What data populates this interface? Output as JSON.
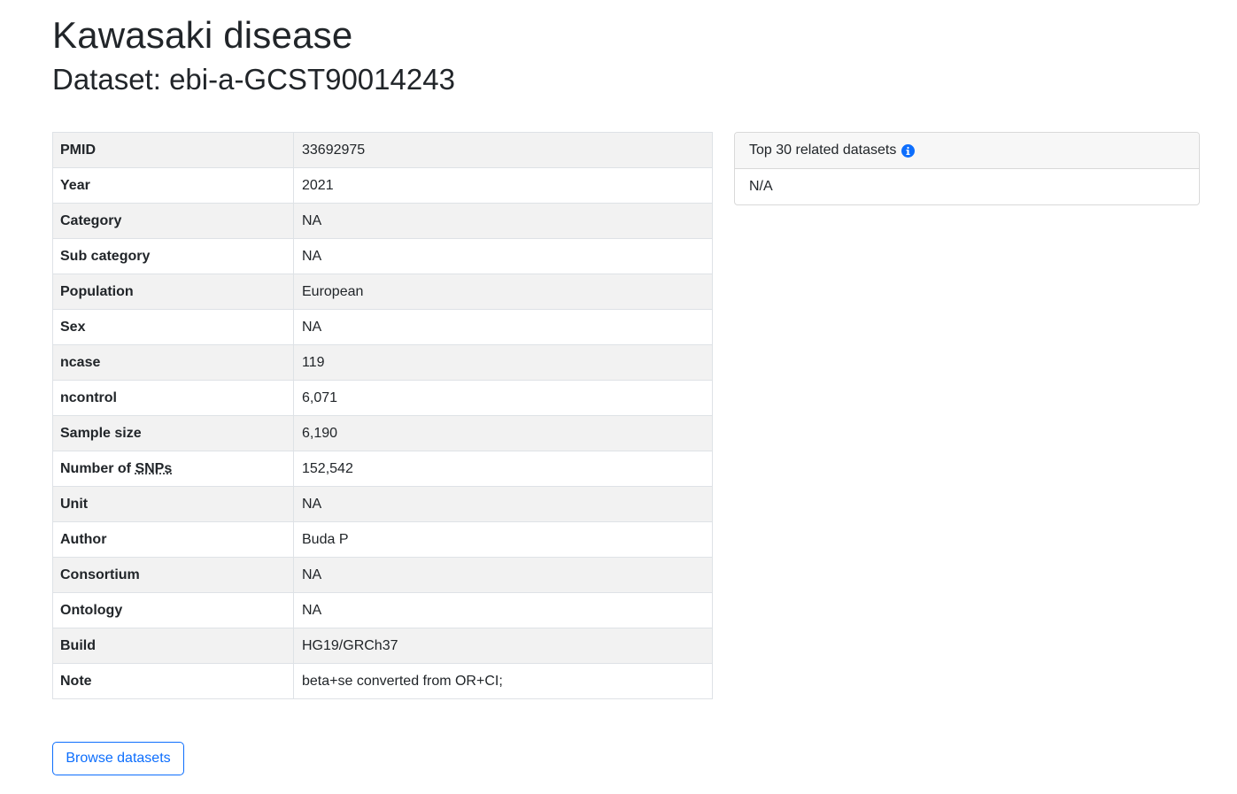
{
  "header": {
    "title": "Kawasaki disease",
    "subtitle": "Dataset: ebi-a-GCST90014243"
  },
  "details": {
    "rows": [
      {
        "key": "PMID",
        "value": "33692975"
      },
      {
        "key": "Year",
        "value": "2021"
      },
      {
        "key": "Category",
        "value": "NA"
      },
      {
        "key": "Sub category",
        "value": "NA"
      },
      {
        "key": "Population",
        "value": "European"
      },
      {
        "key": "Sex",
        "value": "NA"
      },
      {
        "key": "ncase",
        "value": "119"
      },
      {
        "key": "ncontrol",
        "value": "6,071"
      },
      {
        "key": "Sample size",
        "value": "6,190"
      },
      {
        "key_prefix": "Number of ",
        "key_abbr": "SNPs",
        "value": "152,542"
      },
      {
        "key": "Unit",
        "value": "NA"
      },
      {
        "key": "Author",
        "value": "Buda P"
      },
      {
        "key": "Consortium",
        "value": "NA"
      },
      {
        "key": "Ontology",
        "value": "NA"
      },
      {
        "key": "Build",
        "value": "HG19/GRCh37"
      },
      {
        "key": "Note",
        "value": "beta+se converted from OR+CI;"
      }
    ]
  },
  "related": {
    "header": "Top 30 related datasets",
    "info_icon": "info-circle-icon",
    "body": "N/A"
  },
  "actions": {
    "browse_label": "Browse datasets"
  },
  "colors": {
    "text": "#212529",
    "primary": "#0d6efd",
    "stripe": "#f2f2f2",
    "border": "#dee2e6"
  }
}
